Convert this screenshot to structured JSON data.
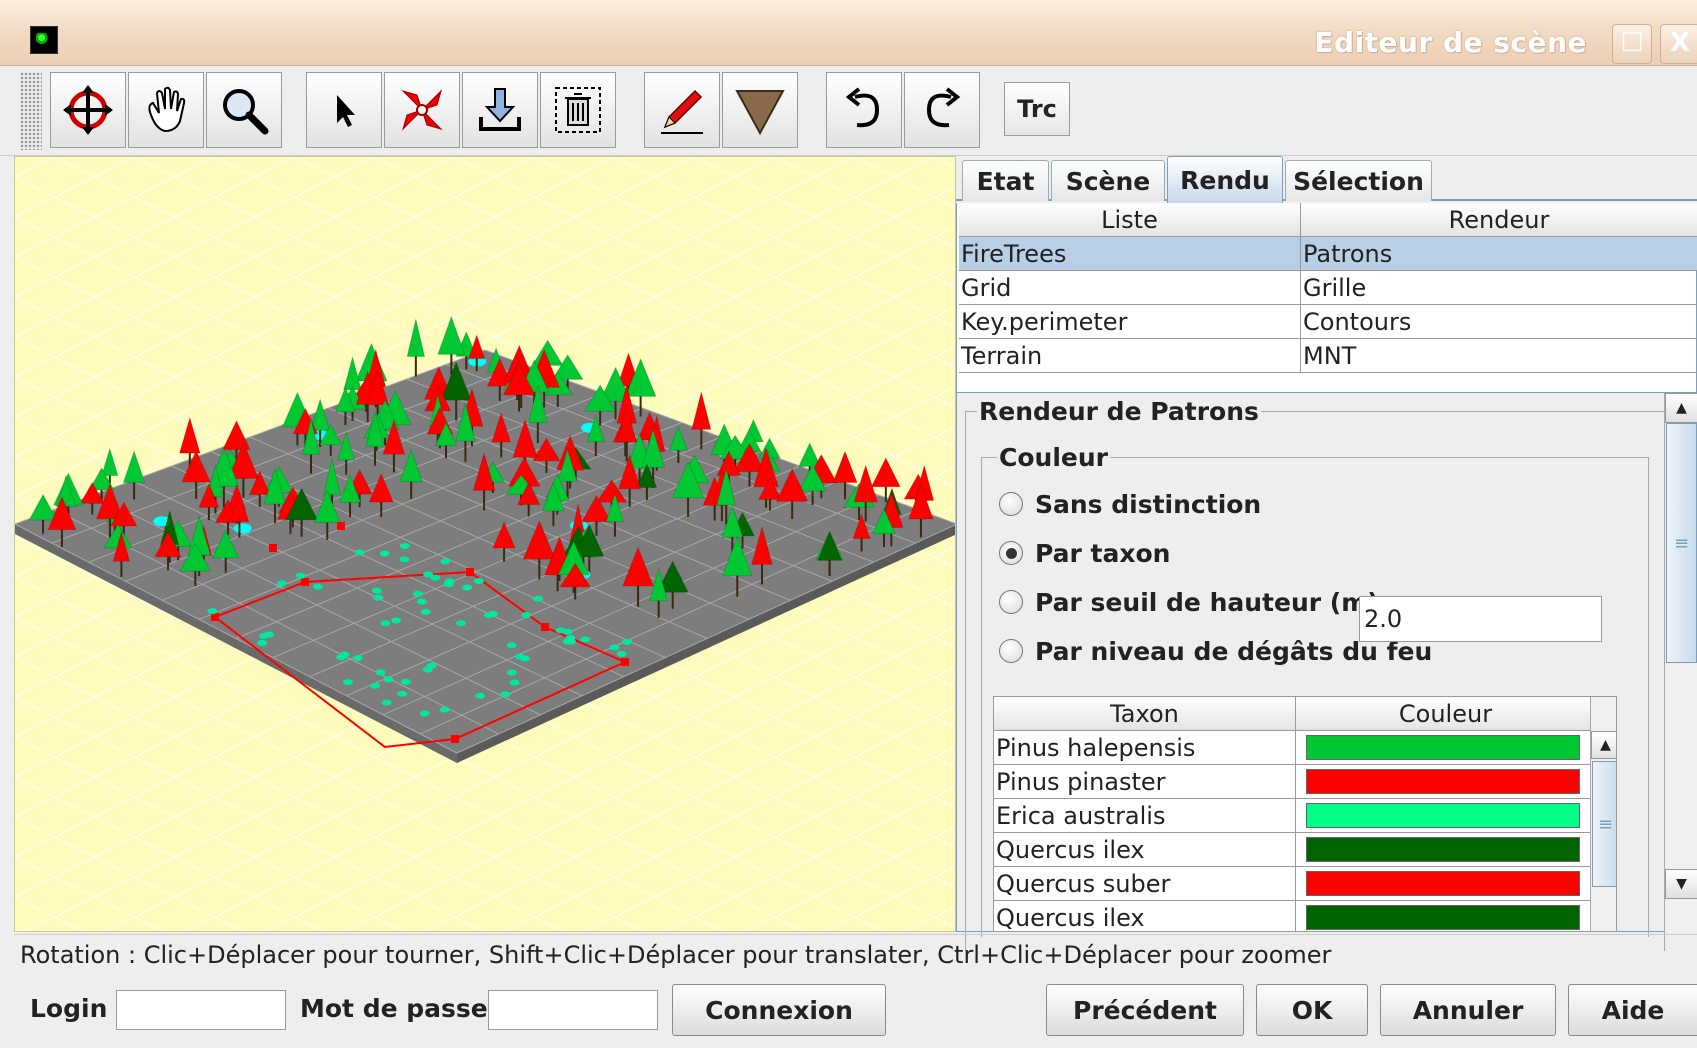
{
  "window": {
    "title": "Editeur de scène",
    "maximize_glyph": "☐",
    "close_glyph": "X"
  },
  "toolbar": {
    "buttons": [
      "rotate-icon",
      "pan-hand-icon",
      "zoom-icon",
      "select-arrow-icon",
      "move-icon",
      "download-icon",
      "delete-icon",
      "pencil-icon",
      "triangle-icon",
      "undo-icon",
      "redo-icon"
    ],
    "trc_label": "Trc"
  },
  "tabs": {
    "items": [
      "Etat",
      "Scène",
      "Rendu",
      "Sélection"
    ],
    "active": "Rendu"
  },
  "list_table": {
    "headers": [
      "Liste",
      "Rendeur"
    ],
    "rows": [
      {
        "liste": "FireTrees",
        "rendeur": "Patrons"
      },
      {
        "liste": "Grid",
        "rendeur": "Grille"
      },
      {
        "liste": "Key.perimeter",
        "rendeur": "Contours"
      },
      {
        "liste": "Terrain",
        "rendeur": "MNT"
      }
    ],
    "selected_row": "FireTrees"
  },
  "renderer": {
    "group_title": "Rendeur de Patrons",
    "color_group_title": "Couleur",
    "options": [
      {
        "label": "Sans distinction",
        "checked": false
      },
      {
        "label": "Par taxon",
        "checked": true
      },
      {
        "label": "Par seuil de hauteur  (m)",
        "checked": false
      },
      {
        "label": "Par niveau de dégâts du feu",
        "checked": false
      }
    ],
    "height_value": "2.0"
  },
  "taxon_table": {
    "headers": [
      "Taxon",
      "Couleur"
    ],
    "rows": [
      {
        "name": "Pinus halepensis",
        "color": "#00c832"
      },
      {
        "name": "Pinus pinaster",
        "color": "#ff0000"
      },
      {
        "name": "Erica australis",
        "color": "#00ff88"
      },
      {
        "name": "Quercus ilex",
        "color": "#006400"
      },
      {
        "name": "Quercus suber",
        "color": "#ff0000"
      },
      {
        "name": "Quercus ilex",
        "color": "#006400"
      }
    ]
  },
  "status": "Rotation : Clic+Déplacer pour tourner, Shift+Clic+Déplacer pour translater, Ctrl+Clic+Déplacer pour zoomer",
  "bottom": {
    "login_label": "Login",
    "password_label": "Mot de passe",
    "connect_label": "Connexion",
    "previous_label": "Précédent",
    "ok_label": "OK",
    "cancel_label": "Annuler",
    "help_label": "Aide"
  },
  "scene": {
    "background": "#fffbbc",
    "ground": "#808080",
    "tree_colors": [
      "#ff0000",
      "#00c832",
      "#006400",
      "#00ffff"
    ]
  }
}
